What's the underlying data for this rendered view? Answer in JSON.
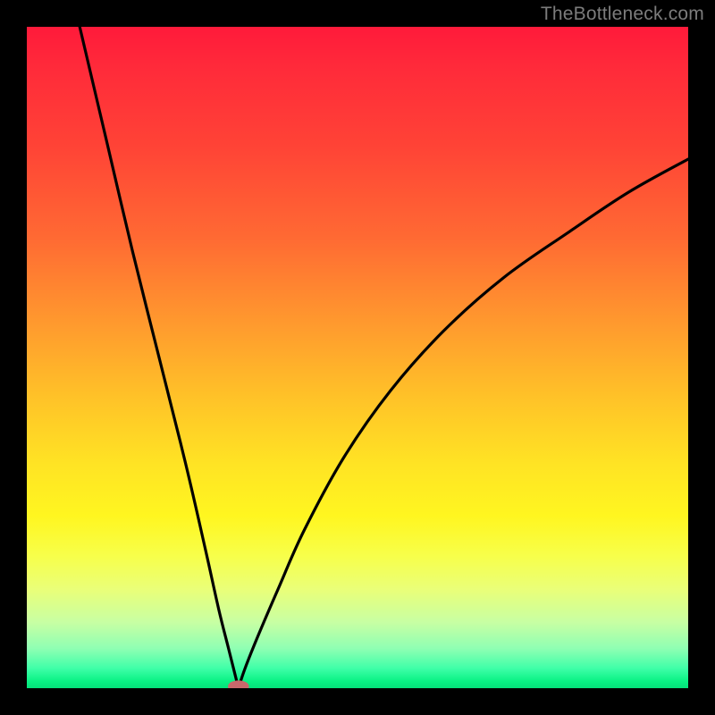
{
  "attribution": "TheBottleneck.com",
  "colors": {
    "frame": "#000000",
    "curve": "#000000",
    "marker_fill": "#c9686b",
    "gradient_top": "#ff1a3a",
    "gradient_mid": "#ffe324",
    "gradient_bottom": "#05e07a"
  },
  "chart_data": {
    "type": "line",
    "title": "",
    "xlabel": "",
    "ylabel": "",
    "xlim": [
      0,
      100
    ],
    "ylim": [
      0,
      100
    ],
    "grid": false,
    "legend": false,
    "notes": "V-shaped curve on a vertical red→yellow→green gradient. Vertex near x≈32, y≈0. Left branch rises steeply to top-left (exits top edge around x≈8, y=100). Right branch rises more gradually toward upper-right (ends near x=100, y≈80). Small rounded marker at the vertex.",
    "series": [
      {
        "name": "left-branch",
        "x": [
          8,
          12,
          16,
          20,
          24,
          27,
          29,
          30.5,
          31.5,
          32
        ],
        "y": [
          100,
          83,
          66,
          50,
          34,
          21,
          12,
          6,
          2,
          0
        ]
      },
      {
        "name": "right-branch",
        "x": [
          32,
          33,
          35,
          38,
          42,
          48,
          55,
          63,
          72,
          82,
          91,
          100
        ],
        "y": [
          0,
          3,
          8,
          15,
          24,
          35,
          45,
          54,
          62,
          69,
          75,
          80
        ]
      }
    ],
    "marker": {
      "x": 32,
      "y": 0,
      "rx": 1.6,
      "ry": 0.9
    }
  }
}
